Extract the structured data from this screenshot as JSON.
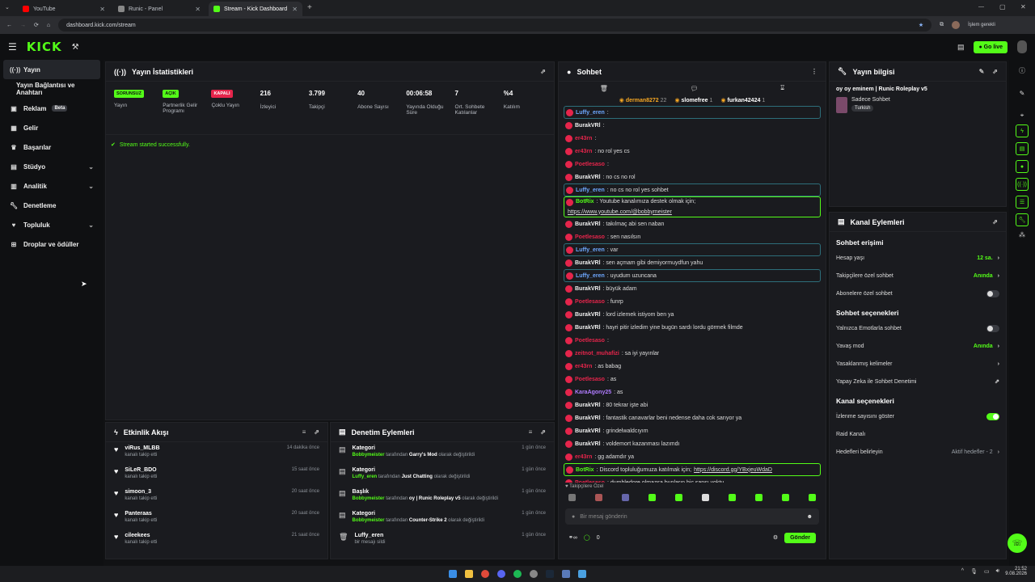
{
  "browser": {
    "tabs": [
      {
        "title": "YouTube",
        "color": "#ff0000",
        "active": false
      },
      {
        "title": "Runic - Panel",
        "color": "#888888",
        "active": false
      },
      {
        "title": "Stream - Kick Dashboard",
        "color": "#53fc18",
        "active": true
      }
    ],
    "url": "dashboard.kick.com/stream",
    "profile_label": "İşlem gerekli"
  },
  "topbar": {
    "logo": "KICK",
    "go_live": "Go live"
  },
  "nav": {
    "items": [
      {
        "label": "Yayın",
        "icon": "broadcast-icon",
        "active": true
      },
      {
        "label": "Yayın Bağlantısı ve Anahtarı",
        "icon": "",
        "active": false
      },
      {
        "label": "Reklam",
        "icon": "ad-icon",
        "badge": "Beta"
      },
      {
        "label": "Gelir",
        "icon": "wallet-icon"
      },
      {
        "label": "Başarılar",
        "icon": "trophy-icon"
      },
      {
        "label": "Stüdyo",
        "icon": "studio-icon",
        "chevron": true
      },
      {
        "label": "Analitik",
        "icon": "chart-icon",
        "chevron": true
      },
      {
        "label": "Denetleme",
        "icon": "wrench-icon"
      },
      {
        "label": "Topluluk",
        "icon": "heart-icon",
        "chevron": true
      },
      {
        "label": "Droplar ve ödüller",
        "icon": "gift-icon"
      }
    ]
  },
  "stats": {
    "title": "Yayın İstatistikleri",
    "cells": [
      {
        "tag": "SORUNSUZ",
        "tag_color": "#53fc18",
        "label": "Yayın"
      },
      {
        "tag": "AÇIK",
        "tag_color": "#53fc18",
        "label": "Partnerlik Gelir Programı"
      },
      {
        "tag": "KAPALI",
        "tag_color": "#e5254b",
        "label": "Çoklu Yayın"
      },
      {
        "value": "216",
        "label": "İzleyici"
      },
      {
        "value": "3.799",
        "label": "Takipçi"
      },
      {
        "value": "40",
        "label": "Abone Sayısı"
      },
      {
        "value": "00:06:58",
        "label": "Yayında Olduğu Süre"
      },
      {
        "value": "7",
        "label": "Ort. Sohbete Katılanlar"
      },
      {
        "value": "%4",
        "label": "Katılım"
      }
    ],
    "message": "Stream started successfully."
  },
  "activity": {
    "title": "Etkinlik Akışı",
    "items": [
      {
        "name": "viRus_MLBB",
        "sub": "kanalı takip etti",
        "time": "14 dakika önce"
      },
      {
        "name": "SiLeR_BDO",
        "sub": "kanalı takip etti",
        "time": "15 saat önce"
      },
      {
        "name": "simoon_3",
        "sub": "kanalı takip etti",
        "time": "20 saat önce"
      },
      {
        "name": "Panteraas",
        "sub": "kanalı takip etti",
        "time": "20 saat önce"
      },
      {
        "name": "cileekees",
        "sub": "kanalı takip etti",
        "time": "21 saat önce"
      }
    ]
  },
  "moderation": {
    "title": "Denetim Eylemleri",
    "items": [
      {
        "title": "Kategori",
        "actor": "Bobbymeister",
        "mid": "tarafından",
        "target": "Garry's Mod",
        "tail": "olarak değiştirildi",
        "time": "1 gün önce"
      },
      {
        "title": "Kategori",
        "actor": "Luffy_eren",
        "mid": "tarafından",
        "target": "Just Chatting",
        "tail": "olarak değiştirildi",
        "time": "1 gün önce"
      },
      {
        "title": "Başlık",
        "actor": "Bobbymeister",
        "mid": "tarafından",
        "target": "oy | Runic Roleplay v5",
        "tail": "olarak değiştirildi",
        "time": "1 gün önce"
      },
      {
        "title": "Kategori",
        "actor": "Bobbymeister",
        "mid": "tarafından",
        "target": "Counter-Strike 2",
        "tail": "olarak değiştirildi",
        "time": "1 gün önce"
      },
      {
        "title": "Luffy_eren",
        "actor": "",
        "mid": "bir mesajı sildi",
        "target": "",
        "tail": "",
        "time": "1 gün önce"
      }
    ]
  },
  "chat": {
    "title": "Sohbet",
    "pinned": [
      {
        "name": "derman8272",
        "count": "22"
      },
      {
        "name": "slomefree",
        "count": "1"
      },
      {
        "name": "furkan42424",
        "count": "1"
      }
    ],
    "lines": [
      {
        "user": "Luffy_eren",
        "color": "#6ea8ff",
        "text": ":",
        "hl": true
      },
      {
        "user": "BurakVRl",
        "color": "#f0f0f0",
        "text": ":"
      },
      {
        "user": "er43rn",
        "color": "#e5254b",
        "text": ":"
      },
      {
        "user": "er43rn",
        "color": "#e5254b",
        "text": ": no rol yes cs"
      },
      {
        "user": "Poetlesaso",
        "color": "#e5254b",
        "text": ":"
      },
      {
        "user": "BurakVRl",
        "color": "#f0f0f0",
        "text": ": no cs no rol"
      },
      {
        "user": "Luffy_eren",
        "color": "#6ea8ff",
        "text": ": no cs no rol yes sohbet",
        "hl": true
      },
      {
        "user": "BotRix",
        "color": "#53fc18",
        "text": ": Youtube kanalımıza destek olmak için;",
        "link": "https://www.youtube.com/@bobbymeister",
        "bot": true
      },
      {
        "user": "BurakVRl",
        "color": "#f0f0f0",
        "text": ": takılmaç abi sen naban"
      },
      {
        "user": "Poetlesaso",
        "color": "#e5254b",
        "text": ": sen nasılsın"
      },
      {
        "user": "Luffy_eren",
        "color": "#6ea8ff",
        "text": ": var",
        "hl": true
      },
      {
        "user": "BurakVRl",
        "color": "#f0f0f0",
        "text": ": sen açmam gibi demiyormuydfun yahu"
      },
      {
        "user": "Luffy_eren",
        "color": "#6ea8ff",
        "text": ": uyudum uzuncana",
        "hl": true
      },
      {
        "user": "BurakVRl",
        "color": "#f0f0f0",
        "text": ": büyük adam"
      },
      {
        "user": "Poetlesaso",
        "color": "#e5254b",
        "text": ": funrp"
      },
      {
        "user": "BurakVRl",
        "color": "#f0f0f0",
        "text": ": lord izlemek istiyom ben ya"
      },
      {
        "user": "BurakVRl",
        "color": "#f0f0f0",
        "text": ": hayri pitir izledim yine bugün sardı lordu görmek filmde"
      },
      {
        "user": "Poetlesaso",
        "color": "#e5254b",
        "text": ":"
      },
      {
        "user": "zeitnot_muhafizi",
        "color": "#e5254b",
        "text": ": sa iyi yayınlar"
      },
      {
        "user": "er43rn",
        "color": "#e5254b",
        "text": ": as babag"
      },
      {
        "user": "Poetlesaso",
        "color": "#e5254b",
        "text": ": as"
      },
      {
        "user": "KaraAgony25",
        "color": "#b07cff",
        "text": ": as"
      },
      {
        "user": "BurakVRl",
        "color": "#f0f0f0",
        "text": ": 80 tekrar işte abi"
      },
      {
        "user": "BurakVRl",
        "color": "#f0f0f0",
        "text": ": fantastik canavarlar beni nedense daha cok sarıyor ya"
      },
      {
        "user": "BurakVRl",
        "color": "#f0f0f0",
        "text": ": grindelwaldcıyım"
      },
      {
        "user": "BurakVRl",
        "color": "#f0f0f0",
        "text": ": voldemort kazanması lazımdı"
      },
      {
        "user": "er43rn",
        "color": "#e5254b",
        "text": ": gg adamdır ya"
      },
      {
        "user": "BotRix",
        "color": "#53fc18",
        "text": ": Discord topluluğumuza katılmak için;",
        "link": "https://discord.gg/YBxjeuWdaD",
        "botinline": true
      },
      {
        "user": "Poetlesaso",
        "color": "#e5254b",
        "text": ": dumbledore olmazsa bunların hiç şansı yoktu"
      }
    ],
    "followers_only": "Takipçilere Özel",
    "input_placeholder": "Bir mesaj gönderin",
    "counter": "0",
    "send": "Gönder"
  },
  "stream_info": {
    "title": "Yayın bilgisi",
    "stream_title": "oy oy eminem | Runic Roleplay v5",
    "category": "Sadece Sohbet",
    "language": "Turkish"
  },
  "channel_actions": {
    "title": "Kanal Eylemleri",
    "chat_access": "Sohbet erişimi",
    "rows1": [
      {
        "label": "Hesap yaşı",
        "value": "12 sa.",
        "type": "value"
      },
      {
        "label": "Takipçilere özel sohbet",
        "value": "Anında",
        "type": "value"
      },
      {
        "label": "Abonelere özel sohbet",
        "type": "toggle",
        "on": false
      }
    ],
    "chat_options": "Sohbet seçenekleri",
    "rows2": [
      {
        "label": "Yalnızca Emotlarla sohbet",
        "type": "toggle",
        "on": false
      },
      {
        "label": "Yavaş mod",
        "value": "Anında",
        "type": "value"
      },
      {
        "label": "Yasaklanmış kelimeler",
        "value": "",
        "type": "chev"
      },
      {
        "label": "Yapay Zeka ile Sohbet Denetimi",
        "value": "",
        "type": "ext"
      }
    ],
    "channel_options": "Kanal seçenekleri",
    "rows3": [
      {
        "label": "İzlenme sayısını göster",
        "type": "toggle",
        "on": true
      },
      {
        "label": "Raid Kanalı",
        "type": "none"
      },
      {
        "label": "Hedefleri belirleyin",
        "value": "Aktif hedefler - 2",
        "type": "value"
      }
    ]
  },
  "taskbar": {
    "time": "21:52",
    "date": "9.08.2026"
  }
}
